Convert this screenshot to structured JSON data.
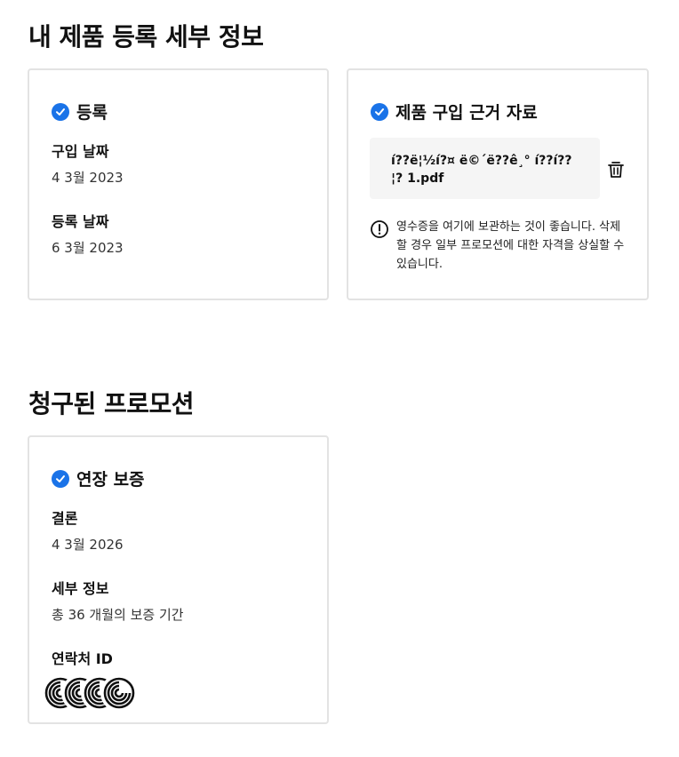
{
  "page": {
    "title": "내 제품 등록 세부 정보"
  },
  "registration": {
    "heading": "등록",
    "purchase_date_label": "구입 날짜",
    "purchase_date_value": "4 3월 2023",
    "registration_date_label": "등록 날짜",
    "registration_date_value": "6 3월 2023"
  },
  "proof": {
    "heading": "제품 구입 근거 자료",
    "file_name": "í??ë¦½í?¤ ë©´ë??ê¸° í??í??¦? 1.pdf",
    "notice": "영수증을 여기에 보관하는 것이 좋습니다. 삭제할 경우 일부 프로모션에 대한 자격을 상실할 수 있습니다."
  },
  "promotions": {
    "title": "청구된 프로모션",
    "item": {
      "heading": "연장 보증",
      "result_label": "결론",
      "result_value": "4 3월 2026",
      "details_label": "세부 정보",
      "details_value": "총 36 개월의 보증 기간",
      "contact_label": "연락처 ID"
    }
  },
  "colors": {
    "accent": "#1a73e8",
    "border": "#e3e3e3",
    "file_bg": "#f5f5f5"
  },
  "icons": {
    "check": "check-circle-icon",
    "trash": "trash-icon",
    "info": "info-circle-icon",
    "avatar": "spiral-avatar-icon"
  }
}
